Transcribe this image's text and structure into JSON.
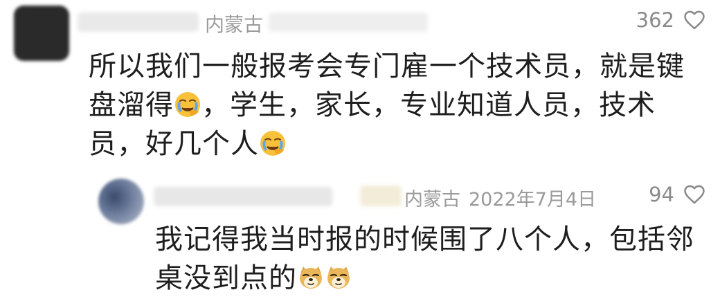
{
  "comments": [
    {
      "location": "内蒙古",
      "likes": "362",
      "text_parts": [
        "所以我们一般报考会专门雇一个技术员，就是键盘溜得",
        "，学生，家长，专业知道人员，技术员，好几个人"
      ],
      "emojis": [
        "facepalm-cry-emoji",
        "facepalm-cry-emoji"
      ]
    },
    {
      "location": "内蒙古",
      "date": "2022年7月4日",
      "likes": "94",
      "text": "我记得我当时报的时候围了八个人，包括邻桌没到点的",
      "emojis": [
        "doge-emoji",
        "doge-emoji"
      ]
    }
  ],
  "colors": {
    "meta_text": "#9a9a9a",
    "body_text": "#1e1e1e",
    "emoji_yellow": "#f7c23a"
  }
}
